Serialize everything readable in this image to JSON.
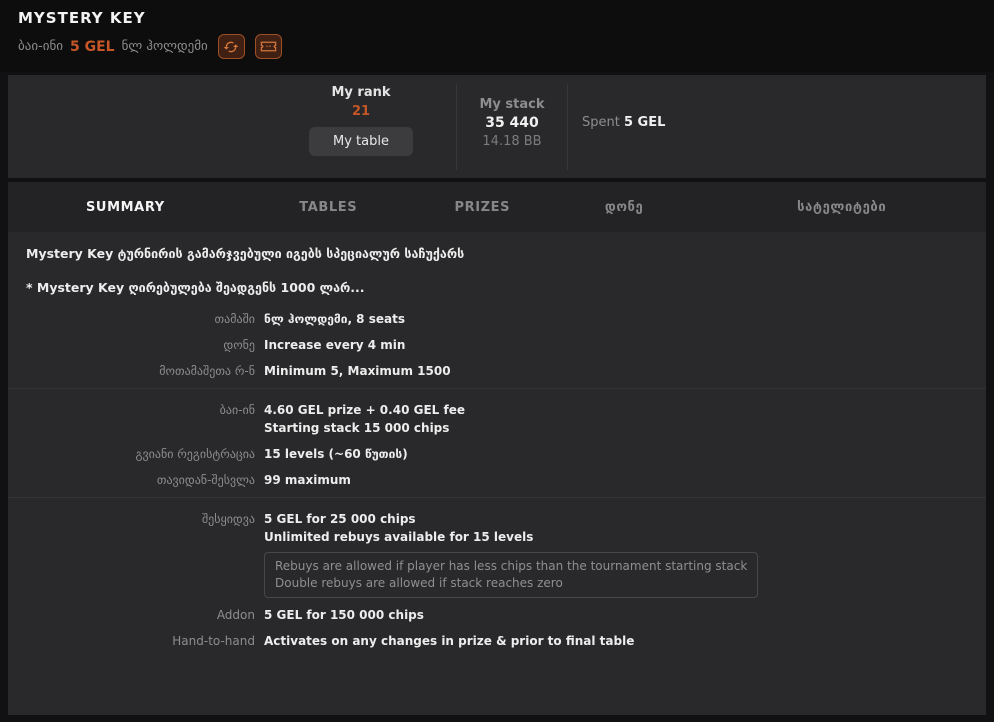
{
  "colors": {
    "accent_orange": "#c65627",
    "panel_bg": "#29292b",
    "tabbar_bg": "#232325",
    "header_bg": "#0d0d0e",
    "page_bg": "#111113",
    "icon_glyph": "#d4763d",
    "icon_border": "#9e4f26",
    "icon_bg": "#3f2012"
  },
  "header": {
    "title": "MYSTERY KEY",
    "buyin_label": "ბაი-ინი",
    "buyin_value": "5 GEL",
    "game_type": "ნლ ჰოლდემი"
  },
  "stats": {
    "my_rank_label": "My rank",
    "my_rank_value": "21",
    "my_table_button": "My table",
    "my_stack_label": "My stack",
    "my_stack_value": "35 440",
    "my_stack_bb": "14.18 BB",
    "spent_label": "Spent",
    "spent_value": "5 GEL"
  },
  "tabs": [
    {
      "label": "SUMMARY",
      "active": true
    },
    {
      "label": "TABLES",
      "active": false
    },
    {
      "label": "PRIZES",
      "active": false
    },
    {
      "label": "დონე",
      "active": false
    },
    {
      "label": "სატელიტები",
      "active": false
    }
  ],
  "content": {
    "intro": [
      "Mystery Key ტურნირის გამარჯვებული იგებს სპეციალურ საჩუქარს",
      "* Mystery Key ღირებულება შეადგენს 1000 ლარ..."
    ],
    "sections": [
      {
        "rows": [
          {
            "label": "თამაში",
            "values": [
              "ნლ ჰოლდემი, 8 seats"
            ]
          },
          {
            "label": "დონე",
            "values": [
              "Increase every 4 min"
            ]
          },
          {
            "label": "მოთამაშეთა რ-ნ",
            "values": [
              "Minimum 5, Maximum 1500"
            ]
          }
        ]
      },
      {
        "rows": [
          {
            "label": "ბაი-ინ",
            "values": [
              "4.60 GEL prize + 0.40 GEL fee",
              "Starting stack 15 000 chips"
            ]
          },
          {
            "label": "გვიანი რეგისტრაცია",
            "values": [
              "15 levels (~60 წუთის)"
            ]
          },
          {
            "label": "თავიდან-შესვლა",
            "values": [
              "99 maximum"
            ]
          }
        ]
      },
      {
        "rows": [
          {
            "label": "შესყიდვა",
            "values": [
              "5 GEL for 25 000 chips",
              "Unlimited rebuys available for 15 levels"
            ],
            "note": [
              "Rebuys are allowed if player has less chips than the tournament starting stack",
              "Double rebuys are allowed if stack reaches zero"
            ]
          },
          {
            "label": "Addon",
            "values": [
              "5 GEL for 150 000 chips"
            ]
          },
          {
            "label": "Hand-to-hand",
            "values": [
              "Activates on any changes in prize & prior to final table"
            ]
          }
        ]
      }
    ]
  }
}
